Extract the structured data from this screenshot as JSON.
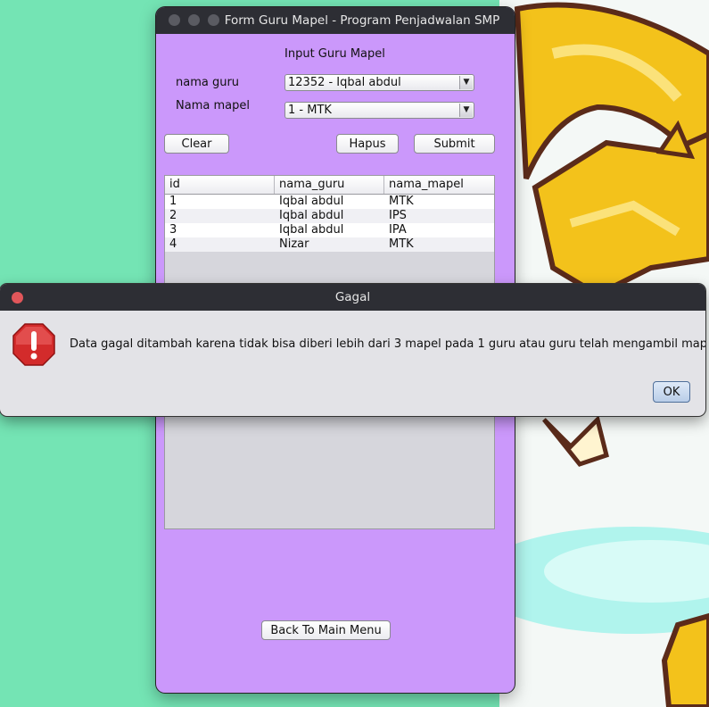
{
  "main_window": {
    "title": "Form Guru Mapel - Program Penjadwalan SMP",
    "heading": "Input Guru Mapel",
    "nama_guru_label": "nama guru",
    "nama_guru_value": "12352 - Iqbal abdul",
    "nama_mapel_label": "Nama mapel",
    "nama_mapel_value": "1 - MTK",
    "clear_label": "Clear",
    "hapus_label": "Hapus",
    "submit_label": "Submit",
    "back_label": "Back To Main Menu",
    "table": {
      "columns": [
        "id",
        "nama_guru",
        "nama_mapel"
      ],
      "rows": [
        [
          "1",
          "Iqbal abdul",
          "MTK"
        ],
        [
          "2",
          "Iqbal abdul",
          "IPS"
        ],
        [
          "3",
          "Iqbal abdul",
          "IPA"
        ],
        [
          "4",
          "Nizar",
          "MTK"
        ]
      ]
    }
  },
  "dialog": {
    "title": "Gagal",
    "message": "Data gagal ditambah karena tidak bisa diberi lebih dari 3 mapel pada 1 guru atau guru telah mengambil mapel",
    "ok_label": "OK",
    "icon": "error-icon"
  },
  "colors": {
    "desktop": "#74e4b4",
    "window_bg": "#cb98fb",
    "titlebar": "#2d2e34",
    "error_icon": "#d32b2b"
  }
}
